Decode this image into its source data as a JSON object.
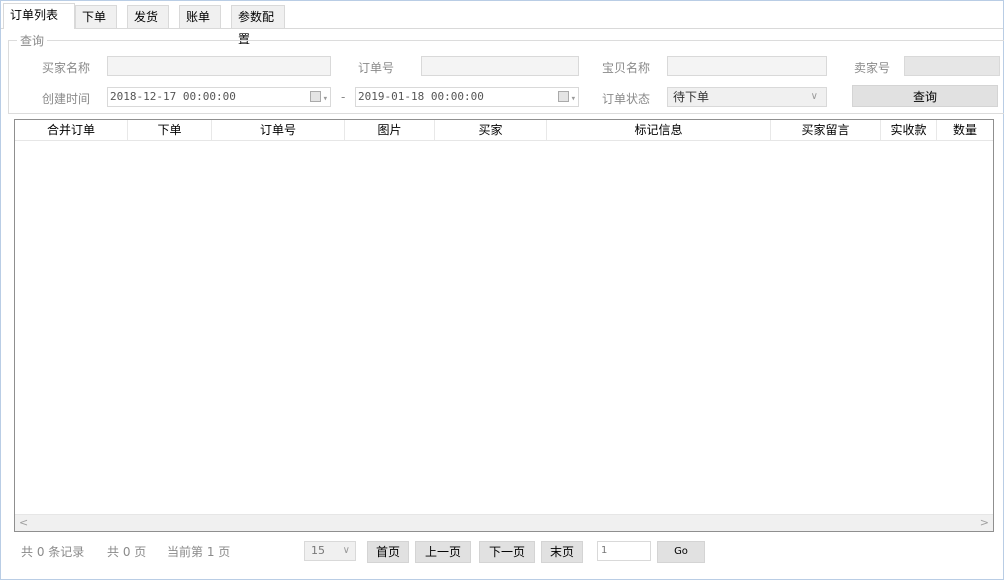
{
  "tabs": [
    "订单列表",
    "下单",
    "发货",
    "账单",
    "参数配置"
  ],
  "query": {
    "title": "查询",
    "buyer_name_label": "买家名称",
    "order_no_label": "订单号",
    "item_name_label": "宝贝名称",
    "seller_no_label": "卖家号",
    "created_label": "创建时间",
    "start_datetime": "2018-12-17 00:00:00",
    "dash": "-",
    "end_datetime": "2019-01-18 00:00:00",
    "status_label": "订单状态",
    "status_value": "待下单",
    "query_button": "查询"
  },
  "table": {
    "columns": [
      "合并订单",
      "下单",
      "订单号",
      "图片",
      "买家",
      "标记信息",
      "买家留言",
      "实收款",
      "数量"
    ],
    "rows": []
  },
  "pager": {
    "total_records": "共 0 条记录",
    "total_pages": "共 0 页",
    "current_page": "当前第 1 页",
    "page_size": "15",
    "first": "首页",
    "prev": "上一页",
    "next": "下一页",
    "last": "末页",
    "page_input": "1",
    "go": "Go"
  }
}
